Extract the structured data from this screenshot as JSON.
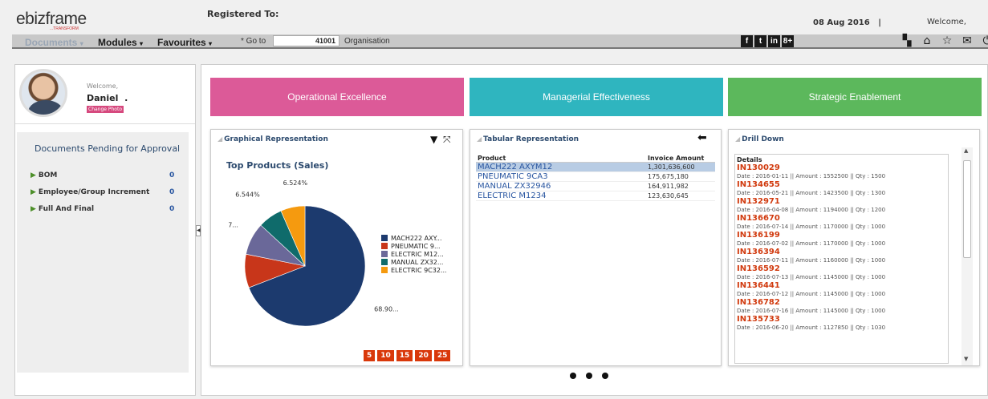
{
  "header": {
    "logo": "ebizframe",
    "logo_sub": "...TRANSFORM",
    "registered_to": "Registered To:",
    "date": "08 Aug 2016",
    "separator": "|",
    "welcome": "Welcome,"
  },
  "nav": {
    "documents": "Documents",
    "modules": "Modules",
    "favourites": "Favourites",
    "goto_label": "* Go to",
    "goto_value": "41001",
    "organisation": "Organisation",
    "social": [
      "f",
      "t",
      "in",
      "8+"
    ],
    "tool_icons": [
      "grid-icon",
      "home-icon",
      "star-icon",
      "mail-icon",
      "power-icon"
    ]
  },
  "profile": {
    "welcome": "Welcome,",
    "name": "Daniel",
    "suffix": ".",
    "change_photo": "Change Photo"
  },
  "pending": {
    "title": "Documents Pending for Approval",
    "items": [
      {
        "label": "BOM",
        "count": "0"
      },
      {
        "label": "Employee/Group Increment",
        "count": "0"
      },
      {
        "label": "Full And Final",
        "count": "0"
      }
    ]
  },
  "tiles": [
    {
      "label": "Operational Excellence",
      "color": "#dc5a98"
    },
    {
      "label": "Managerial Effectiveness",
      "color": "#2fb5bf"
    },
    {
      "label": "Strategic Enablement",
      "color": "#5cb85c"
    }
  ],
  "graphical": {
    "title": "Graphical Representation",
    "chart_title": "Top Products (Sales)",
    "pager": [
      "5",
      "10",
      "15",
      "20",
      "25"
    ]
  },
  "chart_data": {
    "type": "pie",
    "title": "Top Products (Sales)",
    "slices": [
      {
        "label": "MACH222 AXY...",
        "value": 68.9,
        "value_label": "68.90...",
        "color": "#1c3a6e"
      },
      {
        "label": "PNEUMATIC 9...",
        "value": 9.0,
        "value_label": "9...",
        "color": "#c8361a"
      },
      {
        "label": "ELECTRIC M12...",
        "value": 8.7,
        "value_label": "8.7...",
        "color": "#6a6899"
      },
      {
        "label": "MANUAL ZX32...",
        "value": 6.544,
        "value_label": "6.544%",
        "color": "#0f6b6b"
      },
      {
        "label": "ELECTRIC 9C32...",
        "value": 6.524,
        "value_label": "6.524%",
        "color": "#f59a0f"
      }
    ],
    "legend_position": "right"
  },
  "tabular": {
    "title": "Tabular Representation",
    "columns": [
      "Product",
      "Invoice Amount"
    ],
    "rows": [
      {
        "product": "MACH222 AXYM12",
        "amount": "1,301,636,600"
      },
      {
        "product": "PNEUMATIC 9CA3",
        "amount": "175,675,180"
      },
      {
        "product": "MANUAL ZX32946",
        "amount": "164,911,982"
      },
      {
        "product": "ELECTRIC M1234",
        "amount": "123,630,645"
      }
    ]
  },
  "drilldown": {
    "title": "Drill Down",
    "header": "Details",
    "items": [
      {
        "id": "IN130029",
        "detail": "Date : 2016-01-11 || Amount : 1552500 || Qty : 1500"
      },
      {
        "id": "IN134655",
        "detail": "Date : 2016-05-21 || Amount : 1423500 || Qty : 1300"
      },
      {
        "id": "IN132971",
        "detail": "Date : 2016-04-08 || Amount : 1194000 || Qty : 1200"
      },
      {
        "id": "IN136670",
        "detail": "Date : 2016-07-14 || Amount : 1170000 || Qty : 1000"
      },
      {
        "id": "IN136199",
        "detail": "Date : 2016-07-02 || Amount : 1170000 || Qty : 1000"
      },
      {
        "id": "IN136394",
        "detail": "Date : 2016-07-11 || Amount : 1160000 || Qty : 1000"
      },
      {
        "id": "IN136592",
        "detail": "Date : 2016-07-13 || Amount : 1145000 || Qty : 1000"
      },
      {
        "id": "IN136441",
        "detail": "Date : 2016-07-12 || Amount : 1145000 || Qty : 1000"
      },
      {
        "id": "IN136782",
        "detail": "Date : 2016-07-16 || Amount : 1145000 || Qty : 1000"
      },
      {
        "id": "IN135733",
        "detail": "Date : 2016-06-20 || Amount : 1127850 || Qty : 1030"
      }
    ]
  }
}
